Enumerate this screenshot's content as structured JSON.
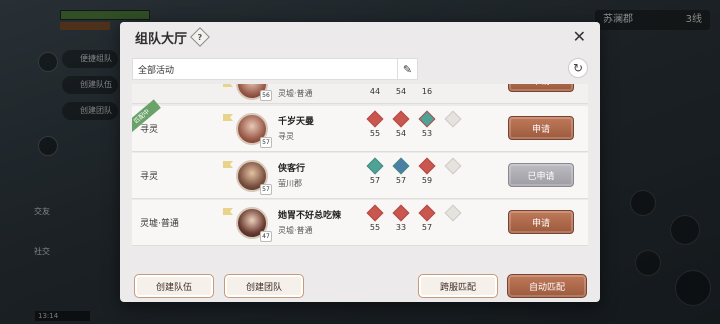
{
  "background": {
    "region_name": "苏澜郡",
    "channel": "3线",
    "side_buttons": [
      "便捷组队",
      "创建队伍",
      "创建团队"
    ],
    "side_icons": [
      "交友",
      "社交"
    ],
    "clock": "13:14"
  },
  "dialog": {
    "title": "组队大厅",
    "help_symbol": "?",
    "close_symbol": "✕",
    "filter_label": "全部活动",
    "edit_symbol": "✎",
    "refresh_symbol": "↻"
  },
  "rows": [
    {
      "activity": "",
      "matching": false,
      "player": {
        "name": "",
        "scene": "灵墟·普通",
        "level": "56"
      },
      "stats": [
        {
          "value": "44",
          "color": "red"
        },
        {
          "value": "54",
          "color": "red"
        },
        {
          "value": "16",
          "color": "teal"
        }
      ],
      "button": "申请"
    },
    {
      "activity": "寻灵",
      "matching": true,
      "matching_label": "匹配中",
      "player": {
        "name": "千岁天曼",
        "scene": "寻灵",
        "level": "57"
      },
      "stats": [
        {
          "value": "55",
          "color": "red"
        },
        {
          "value": "54",
          "color": "red"
        },
        {
          "value": "53",
          "color": "teal"
        }
      ],
      "button": "申请"
    },
    {
      "activity": "寻灵",
      "matching": false,
      "player": {
        "name": "侠客行",
        "scene": "萤川郡",
        "level": "57"
      },
      "stats": [
        {
          "value": "57",
          "color": "teal"
        },
        {
          "value": "57",
          "color": "blue"
        },
        {
          "value": "59",
          "color": "red"
        }
      ],
      "button": "已申请"
    },
    {
      "activity": "灵墟·普通",
      "matching": false,
      "player": {
        "name": "她胃不好总吃辣",
        "scene": "灵墟·普通",
        "level": "47"
      },
      "stats": [
        {
          "value": "55",
          "color": "red"
        },
        {
          "value": "33",
          "color": "red"
        },
        {
          "value": "57",
          "color": "red"
        }
      ],
      "button": "申请"
    }
  ],
  "footer": {
    "create_party": "创建队伍",
    "create_team": "创建团队",
    "cross_server": "跨服匹配",
    "auto_match": "自动匹配"
  }
}
